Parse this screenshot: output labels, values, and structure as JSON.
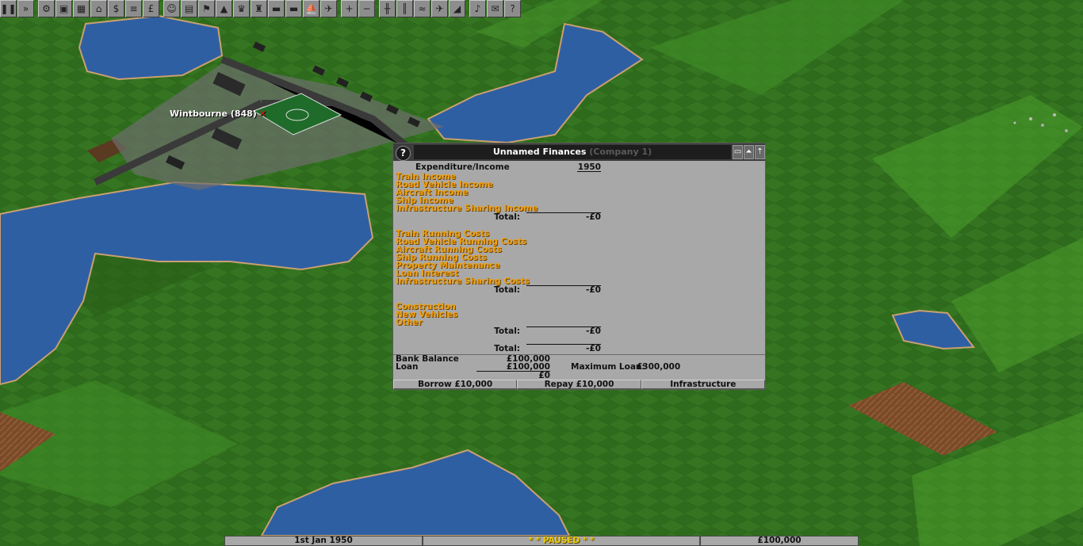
{
  "toolbar": {
    "buttons": [
      {
        "name": "pause-icon",
        "glyph": "❚❚"
      },
      {
        "name": "fast-forward-icon",
        "glyph": "»"
      },
      {
        "name": "settings-gear-icon",
        "glyph": "⚙"
      },
      {
        "name": "save-disk-icon",
        "glyph": "▣"
      },
      {
        "name": "map-icon",
        "glyph": "▦"
      },
      {
        "name": "town-directory-icon",
        "glyph": "⌂"
      },
      {
        "name": "subsidies-icon",
        "glyph": "$"
      },
      {
        "name": "station-list-icon",
        "glyph": "≡"
      },
      {
        "name": "finances-icon",
        "glyph": "£"
      },
      {
        "name": "company-icon",
        "glyph": "☺"
      },
      {
        "name": "story-book-icon",
        "glyph": "▤"
      },
      {
        "name": "goals-icon",
        "glyph": "⚑"
      },
      {
        "name": "graphs-icon",
        "glyph": "▲"
      },
      {
        "name": "league-table-icon",
        "glyph": "♛"
      },
      {
        "name": "industry-icon",
        "glyph": "♜"
      },
      {
        "name": "train-list-icon",
        "glyph": "▬"
      },
      {
        "name": "road-vehicle-list-icon",
        "glyph": "▬"
      },
      {
        "name": "ship-list-icon",
        "glyph": "⛵"
      },
      {
        "name": "aircraft-list-icon",
        "glyph": "✈"
      },
      {
        "name": "zoom-in-icon",
        "glyph": "+"
      },
      {
        "name": "zoom-out-icon",
        "glyph": "−"
      },
      {
        "name": "build-railway-icon",
        "glyph": "╫"
      },
      {
        "name": "build-road-icon",
        "glyph": "║"
      },
      {
        "name": "build-waterways-icon",
        "glyph": "≈"
      },
      {
        "name": "build-airport-icon",
        "glyph": "✈"
      },
      {
        "name": "landscaping-icon",
        "glyph": "◢"
      },
      {
        "name": "music-sound-icon",
        "glyph": "♪"
      },
      {
        "name": "messages-icon",
        "glyph": "✉"
      },
      {
        "name": "help-icon",
        "glyph": "?"
      }
    ]
  },
  "map": {
    "town_label": "Wintbourne (848)",
    "town_marker": "✕"
  },
  "finance_window": {
    "help": "?",
    "title_main": "Unnamed Finances",
    "title_company": "(Company 1)",
    "header_label": "Expenditure/Income",
    "year": "1950",
    "income_items": [
      "Train Income",
      "Road Vehicle Income",
      "Aircraft Income",
      "Ship Income",
      "Infrastructure Sharing Income"
    ],
    "income_total_label": "Total:",
    "income_total": "-£0",
    "cost_items": [
      "Train Running Costs",
      "Road Vehicle Running Costs",
      "Aircraft Running Costs",
      "Ship Running Costs",
      "Property Maintenance",
      "Loan Interest",
      "Infrastructure Sharing Costs"
    ],
    "cost_total_label": "Total:",
    "cost_total": "-£0",
    "capital_items": [
      "Construction",
      "New Vehicles",
      "Other"
    ],
    "capital_total_label": "Total:",
    "capital_total": "-£0",
    "grand_total_label": "Total:",
    "grand_total": "-£0",
    "bank_balance_label": "Bank Balance",
    "bank_balance": "£100,000",
    "loan_label": "Loan",
    "loan": "£100,000",
    "net_value": "£0",
    "max_loan_label": "Maximum Loan:",
    "max_loan": "£300,000",
    "buttons": {
      "borrow": "Borrow £10,000",
      "repay": "Repay £10,000",
      "infrastructure": "Infrastructure"
    }
  },
  "status_bar": {
    "date": "1st Jan 1950",
    "paused": "* * PAUSED * *",
    "money": "£100,000"
  },
  "colors": {
    "grass": "#2f6b1c",
    "water": "#2f5fa3",
    "orange_text": "#f0a010",
    "window_bg": "#a8a8a8"
  }
}
